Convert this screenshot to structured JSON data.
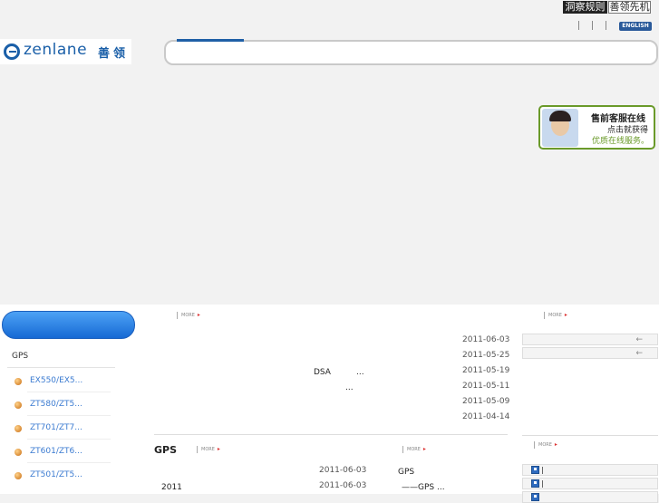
{
  "header": {
    "slogan_a": "洞察规则",
    "slogan_b": "善领先机",
    "english_link": "ENGLISH"
  },
  "logo": {
    "brand": "zenlane",
    "brand_cn": "善领"
  },
  "chat_widget": {
    "line1": "售前客服在线",
    "line2": "点击就获得",
    "line3": "优质在线服务。"
  },
  "sidebar": {
    "category_title": "GPS",
    "products": [
      {
        "label": "EX550/EX5..."
      },
      {
        "label": "ZT580/ZT5..."
      },
      {
        "label": "ZT701/ZT7..."
      },
      {
        "label": "ZT601/ZT6..."
      },
      {
        "label": "ZT501/ZT5..."
      }
    ]
  },
  "more_label": "MORE",
  "news": {
    "dates": [
      "2011-06-03",
      "2011-05-25",
      "2011-05-19",
      "2011-05-11",
      "2011-05-09",
      "2011-04-14"
    ],
    "item_dsa": "DSA",
    "ellipsis_a": "...",
    "ellipsis_b": "..."
  },
  "gps_section": {
    "title": "GPS",
    "dates": [
      "2011-06-03",
      "2011-06-03"
    ],
    "item_year": "2011"
  },
  "mid_section": {
    "item1": "GPS",
    "item2": "——GPS ..."
  },
  "right_icons": {
    "back_icon": "←"
  }
}
